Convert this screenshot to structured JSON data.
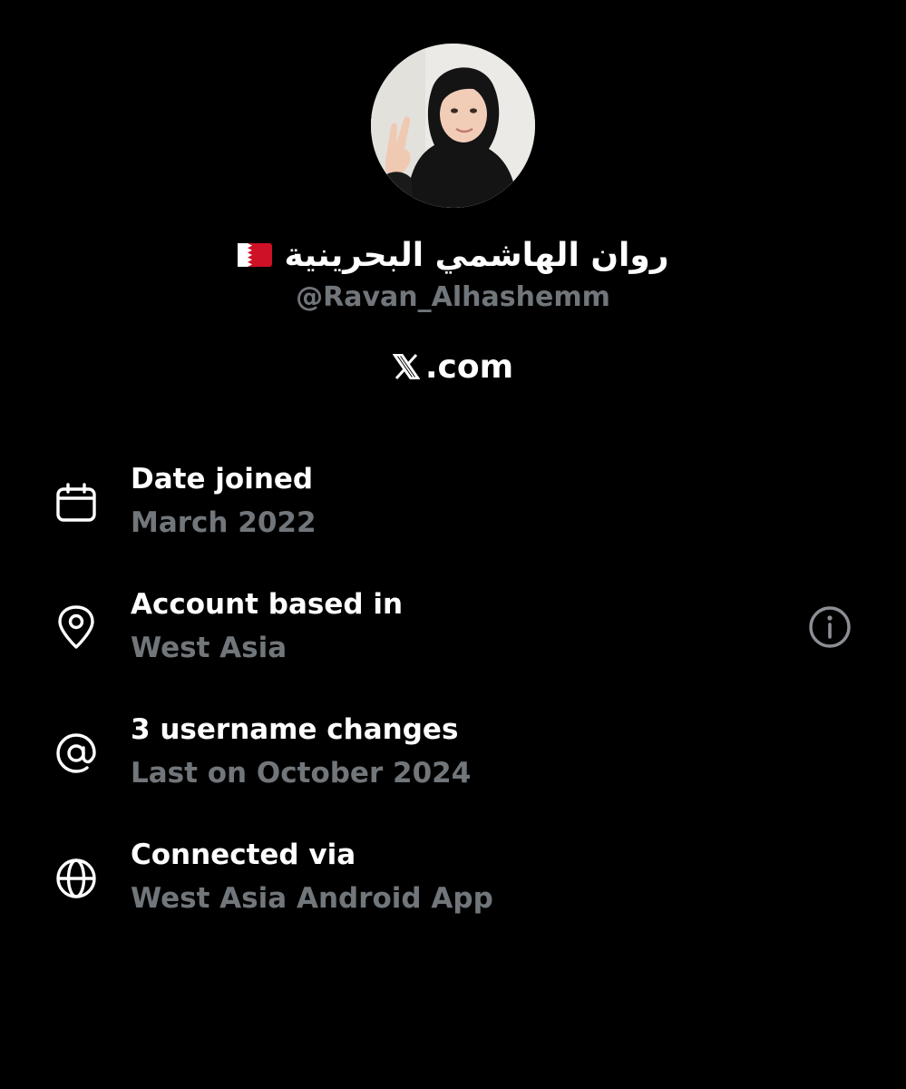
{
  "profile": {
    "display_name": "روان الهاشمي البحرينية",
    "flag_icon": "bahrain-flag-icon",
    "handle": "@Ravan_Alhashemm",
    "site_icon": "x-logo-icon",
    "site_text": ".com"
  },
  "details": [
    {
      "icon": "calendar-icon",
      "title": "Date joined",
      "value": "March 2022"
    },
    {
      "icon": "location-pin-icon",
      "title": "Account based in",
      "value": "West Asia"
    },
    {
      "icon": "at-sign-icon",
      "title": "3 username changes",
      "value": "Last on October 2024"
    },
    {
      "icon": "globe-icon",
      "title": "Connected via",
      "value": "West Asia Android App"
    }
  ],
  "colors": {
    "background": "#000000",
    "primary_text": "#ffffff",
    "secondary_text": "#71767b",
    "flag_red": "#ce1126"
  },
  "info_icon": "info-icon"
}
